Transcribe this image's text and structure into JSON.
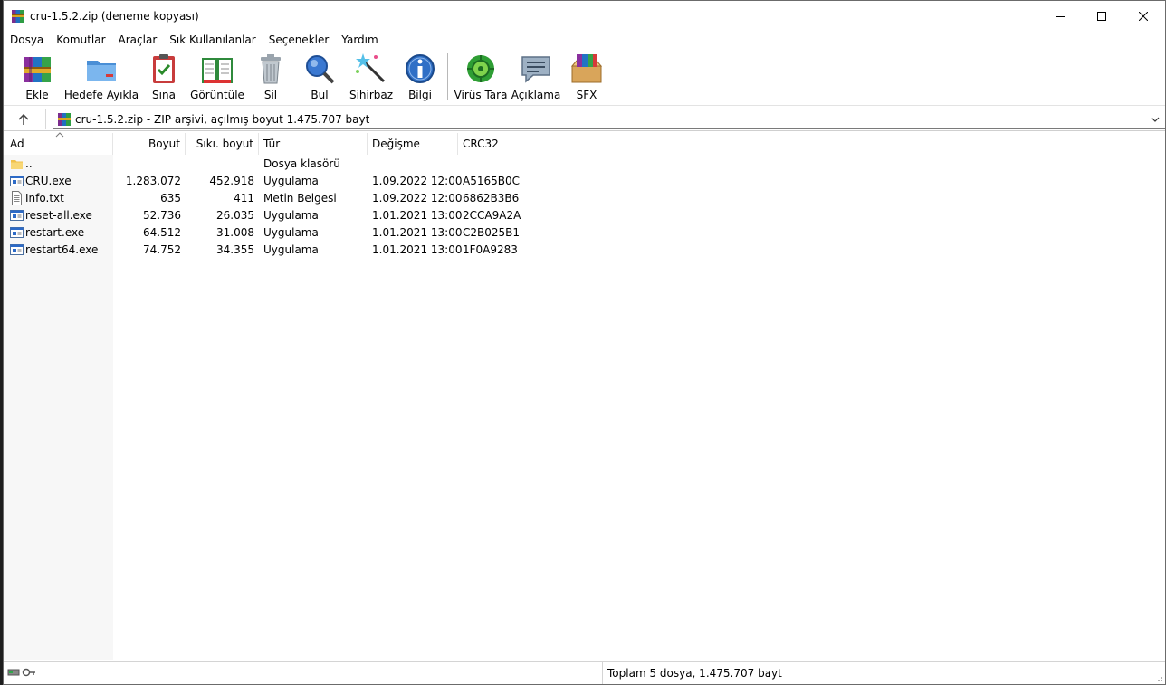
{
  "window": {
    "title": "cru-1.5.2.zip (deneme kopyası)"
  },
  "menu": [
    "Dosya",
    "Komutlar",
    "Araçlar",
    "Sık Kullanılanlar",
    "Seçenekler",
    "Yardım"
  ],
  "toolbar": {
    "add": "Ekle",
    "extract": "Hedefe Ayıkla",
    "test": "Sına",
    "view": "Görüntüle",
    "delete": "Sil",
    "find": "Bul",
    "wizard": "Sihirbaz",
    "info": "Bilgi",
    "virus": "Virüs Tara",
    "comment": "Açıklama",
    "sfx": "SFX"
  },
  "address": {
    "path": "cru-1.5.2.zip - ZIP arşivi, açılmış boyut 1.475.707 bayt"
  },
  "columns": {
    "name": "Ad",
    "size": "Boyut",
    "packed": "Sıkı. boyut",
    "type": "Tür",
    "modified": "Değişme",
    "crc": "CRC32"
  },
  "files": [
    {
      "name": "..",
      "size": "",
      "packed": "",
      "type": "Dosya klasörü",
      "modified": "",
      "crc": "",
      "icon": "folder-icon"
    },
    {
      "name": "CRU.exe",
      "size": "1.283.072",
      "packed": "452.918",
      "type": "Uygulama",
      "modified": "1.09.2022 12:00",
      "crc": "A5165B0C",
      "icon": "exe-icon"
    },
    {
      "name": "Info.txt",
      "size": "635",
      "packed": "411",
      "type": "Metin Belgesi",
      "modified": "1.09.2022 12:00",
      "crc": "6862B3B6",
      "icon": "text-file-icon"
    },
    {
      "name": "reset-all.exe",
      "size": "52.736",
      "packed": "26.035",
      "type": "Uygulama",
      "modified": "1.01.2021 13:00",
      "crc": "2CCA9A2A",
      "icon": "exe-icon"
    },
    {
      "name": "restart.exe",
      "size": "64.512",
      "packed": "31.008",
      "type": "Uygulama",
      "modified": "1.01.2021 13:00",
      "crc": "C2B025B1",
      "icon": "exe-icon"
    },
    {
      "name": "restart64.exe",
      "size": "74.752",
      "packed": "34.355",
      "type": "Uygulama",
      "modified": "1.01.2021 13:00",
      "crc": "1F0A9283",
      "icon": "exe-icon"
    }
  ],
  "status": {
    "summary": "Toplam 5 dosya, 1.475.707 bayt"
  }
}
